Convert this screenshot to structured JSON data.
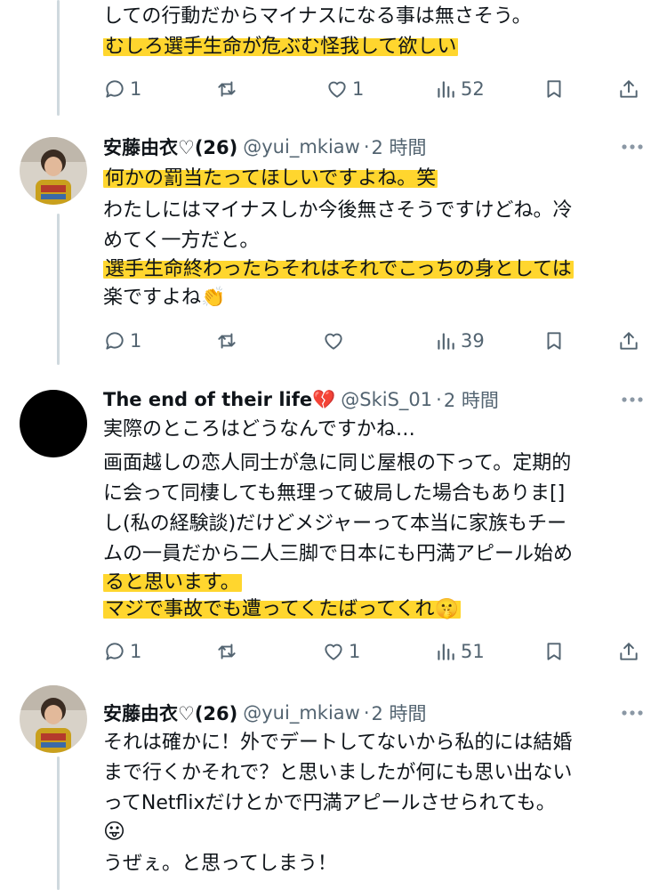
{
  "tweets": [
    {
      "lines": [
        {
          "text": "しての行動だからマイナスになる事は無さそう。",
          "highlight": false
        },
        {
          "text": "むしろ選手生命が危ぶむ怪我して欲しい",
          "highlight": true
        }
      ],
      "actions": {
        "reply": "1",
        "retweet": "",
        "like": "1",
        "views": "52"
      }
    },
    {
      "name": "安藤由衣♡(26)",
      "handle": "@yui_mkiaw",
      "time": "2 時間",
      "lines": [
        {
          "text": "何かの罰当たってほしいですよね。笑",
          "highlight": true
        },
        {
          "text": "わたしにはマイナスしか今後無さそうですけどね。冷",
          "highlight": false
        },
        {
          "text": "めてく一方だと。",
          "highlight": false
        },
        {
          "text": "選手生命終わったらそれはそれでこっちの身としては",
          "highlight": true
        },
        {
          "text": "楽ですよね👏",
          "highlight": false
        }
      ],
      "actions": {
        "reply": "1",
        "retweet": "",
        "like": "",
        "views": "39"
      }
    },
    {
      "name": "The end of their life💔",
      "handle": "@SkiS_01",
      "time": "2 時間",
      "lines": [
        {
          "text": "実際のところはどうなんですかね…",
          "highlight": false
        },
        {
          "text": "画面越しの恋人同士が急に同じ屋根の下って。定期的",
          "highlight": false
        },
        {
          "text": "に会って同棲しても無理って破局した場合もありま[]",
          "highlight": false
        },
        {
          "text": "し(私の経験談)だけどメジャーって本当に家族もチー",
          "highlight": false
        },
        {
          "text": "ムの一員だから二人三脚で日本にも円満アピール始め",
          "highlight": false
        },
        {
          "text": "ると思います。",
          "highlight": false
        },
        {
          "text": "マジで事故でも遭ってくたばってくれ🤫",
          "highlight": true
        }
      ],
      "actions": {
        "reply": "1",
        "retweet": "",
        "like": "1",
        "views": "51"
      }
    },
    {
      "name": "安藤由衣♡(26)",
      "handle": "@yui_mkiaw",
      "time": "2 時間",
      "lines": [
        {
          "text": "それは確かに！外でデートしてないから私的には結婚",
          "highlight": false
        },
        {
          "text": "まで行くかそれで？と思いましたが何にも思い出ない",
          "highlight": false
        },
        {
          "text": "ってNetflixだけとかで円満アピールさせられても。",
          "highlight": false
        },
        {
          "text": "😛",
          "highlight": false
        },
        {
          "text": "うぜぇ。と思ってしまう！",
          "highlight": false
        }
      ]
    }
  ],
  "colors": {
    "highlight": "#ffcd00",
    "muted": "#536471",
    "thread_line": "#cfd9de"
  },
  "icons": [
    "reply-icon",
    "retweet-icon",
    "like-icon",
    "views-icon",
    "bookmark-icon",
    "share-icon",
    "more-icon"
  ]
}
